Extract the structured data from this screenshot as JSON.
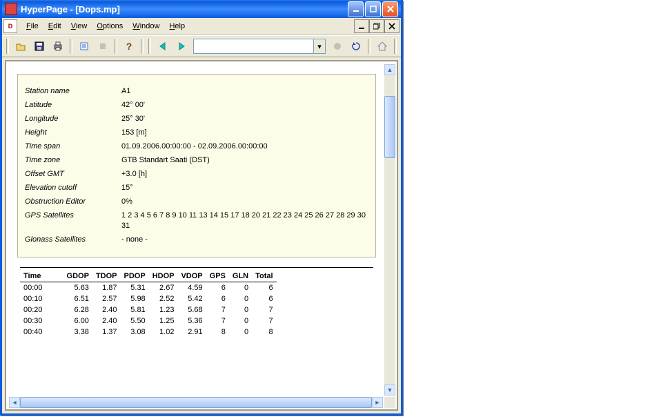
{
  "titlebar": {
    "app": "HyperPage",
    "doc": "[Dops.mp]"
  },
  "menu": {
    "file": "File",
    "edit": "Edit",
    "view": "View",
    "options": "Options",
    "window": "Window",
    "help": "Help"
  },
  "toolbar": {
    "url_value": ""
  },
  "info": {
    "station_name": {
      "label": "Station name",
      "value": "A1"
    },
    "latitude": {
      "label": "Latitude",
      "value": "42° 00'"
    },
    "longitude": {
      "label": "Longitude",
      "value": "25° 30'"
    },
    "height": {
      "label": "Height",
      "value": "153 [m]"
    },
    "time_span": {
      "label": "Time span",
      "value": "01.09.2006.00:00:00 - 02.09.2006.00:00:00"
    },
    "time_zone": {
      "label": "Time zone",
      "value": "GTB Standart Saati (DST)"
    },
    "offset_gmt": {
      "label": "Offset GMT",
      "value": "+3.0 [h]"
    },
    "elevation_cutoff": {
      "label": "Elevation cutoff",
      "value": "15°"
    },
    "obstruction_editor": {
      "label": "Obstruction Editor",
      "value": "0%"
    },
    "gps_satellites": {
      "label": "GPS Satellites",
      "value": "1 2 3 4 5 6 7 8 9 10 11 13 14 15 17 18 20 21 22 23 24 25 26 27 28 29 30 31"
    },
    "glonass_satellites": {
      "label": "Glonass Satellites",
      "value": "- none -"
    }
  },
  "table": {
    "headers": {
      "time": "Time",
      "gdop": "GDOP",
      "tdop": "TDOP",
      "pdop": "PDOP",
      "hdop": "HDOP",
      "vdop": "VDOP",
      "gps": "GPS",
      "gln": "GLN",
      "total": "Total"
    },
    "rows": [
      {
        "time": "00:00",
        "gdop": "5.63",
        "tdop": "1.87",
        "pdop": "5.31",
        "hdop": "2.67",
        "vdop": "4.59",
        "gps": "6",
        "gln": "0",
        "total": "6"
      },
      {
        "time": "00:10",
        "gdop": "6.51",
        "tdop": "2.57",
        "pdop": "5.98",
        "hdop": "2.52",
        "vdop": "5.42",
        "gps": "6",
        "gln": "0",
        "total": "6"
      },
      {
        "time": "00:20",
        "gdop": "6.28",
        "tdop": "2.40",
        "pdop": "5.81",
        "hdop": "1.23",
        "vdop": "5.68",
        "gps": "7",
        "gln": "0",
        "total": "7"
      },
      {
        "time": "00:30",
        "gdop": "6.00",
        "tdop": "2.40",
        "pdop": "5.50",
        "hdop": "1.25",
        "vdop": "5.36",
        "gps": "7",
        "gln": "0",
        "total": "7"
      },
      {
        "time": "00:40",
        "gdop": "3.38",
        "tdop": "1.37",
        "pdop": "3.08",
        "hdop": "1.02",
        "vdop": "2.91",
        "gps": "8",
        "gln": "0",
        "total": "8"
      }
    ]
  }
}
